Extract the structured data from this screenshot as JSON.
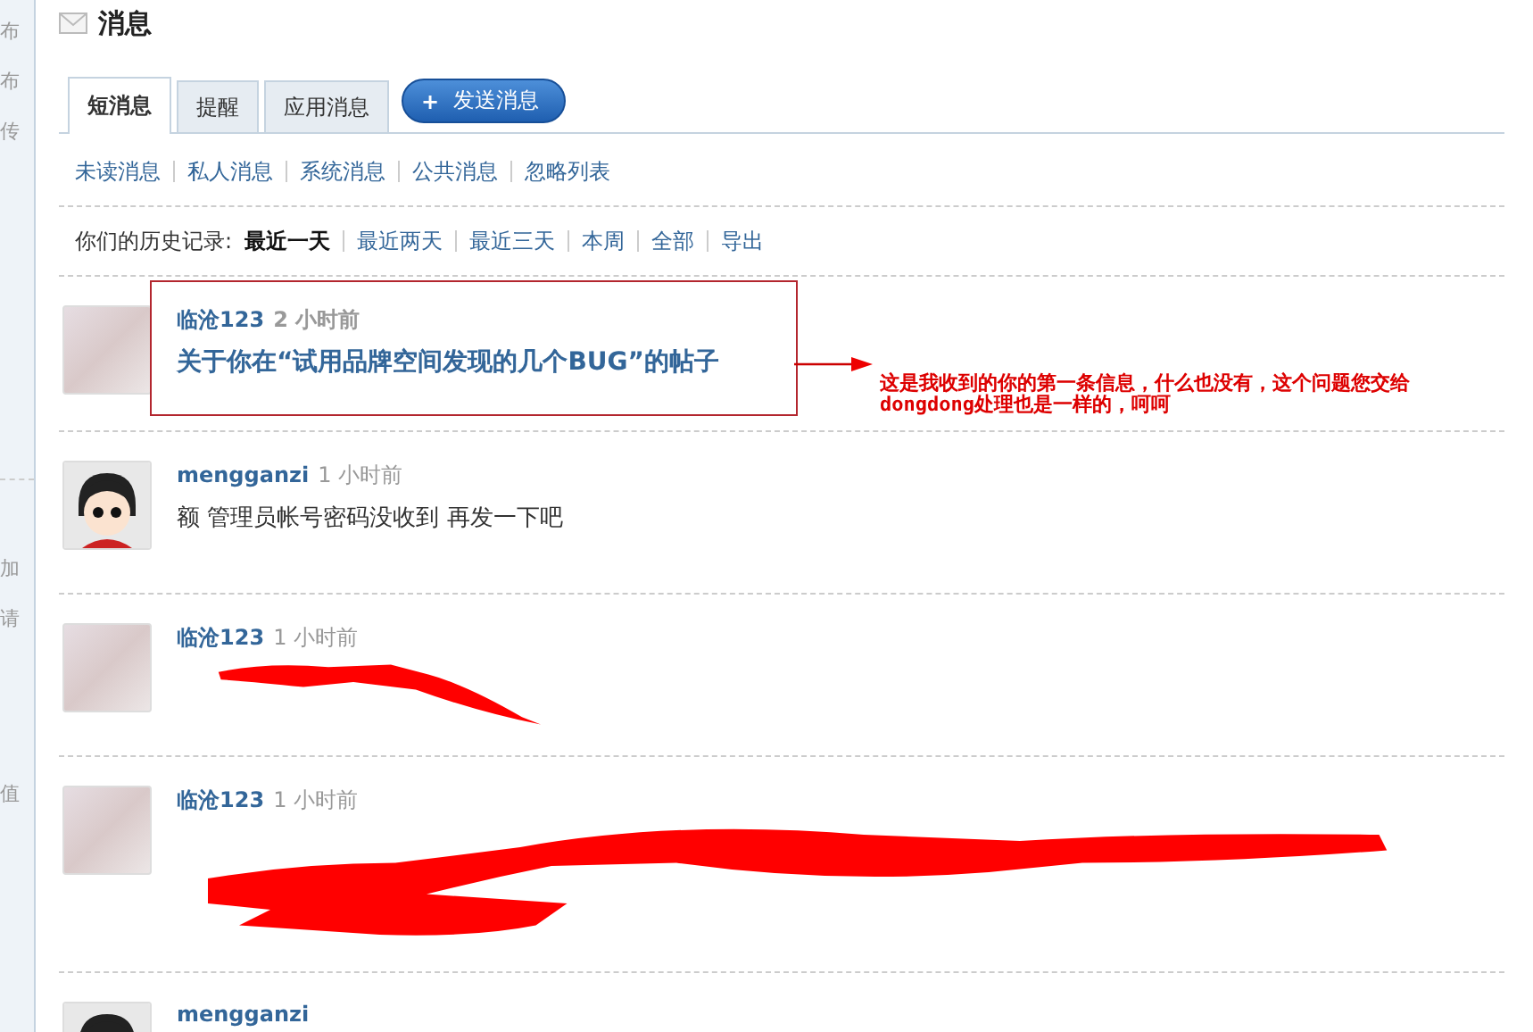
{
  "sidebar": {
    "groups": [
      [
        "布",
        "布",
        "传"
      ],
      [
        "加",
        "请"
      ],
      [
        "值"
      ]
    ]
  },
  "page": {
    "title": "消息"
  },
  "tabs": [
    {
      "label": "短消息",
      "selected": true
    },
    {
      "label": "提醒",
      "selected": false
    },
    {
      "label": "应用消息",
      "selected": false
    }
  ],
  "send_button": {
    "icon": "+",
    "label": "发送消息"
  },
  "filters": [
    "未读消息",
    "私人消息",
    "系统消息",
    "公共消息",
    "忽略列表"
  ],
  "history": {
    "label": "你们的历史记录:",
    "options": [
      {
        "label": "最近一天",
        "selected": true
      },
      {
        "label": "最近两天",
        "selected": false
      },
      {
        "label": "最近三天",
        "selected": false
      },
      {
        "label": "本周",
        "selected": false
      },
      {
        "label": "全部",
        "selected": false
      },
      {
        "label": "导出",
        "selected": false
      }
    ]
  },
  "messages": [
    {
      "author": "临沧123",
      "time": "2 小时前",
      "avatar": {
        "kind": "photo"
      },
      "kind": "subject",
      "body": "关于你在“试用品牌空间发现的几个BUG”的帖子",
      "annotated": true
    },
    {
      "author": "mengganzi",
      "time": "1 小时前",
      "avatar": {
        "kind": "cartoon"
      },
      "kind": "text",
      "body": "额 管理员帐号密码没收到 再发一下吧",
      "annotated": false
    },
    {
      "author": "临沧123",
      "time": "1 小时前",
      "avatar": {
        "kind": "photo"
      },
      "kind": "redacted",
      "redaction": {
        "kind": "short"
      },
      "annotated": false
    },
    {
      "author": "临沧123",
      "time": "1 小时前",
      "avatar": {
        "kind": "photo"
      },
      "kind": "redacted",
      "redaction": {
        "kind": "long"
      },
      "annotated": false
    },
    {
      "author": "mengganzi",
      "avatar": {
        "kind": "cartoon"
      },
      "kind": "cut",
      "annotated": false
    }
  ],
  "annotation": {
    "note_lines": [
      "这是我收到的你的第一条信息，什么也没有，这个问题您交给",
      "dongdong处理也是一样的，呵呵"
    ]
  }
}
